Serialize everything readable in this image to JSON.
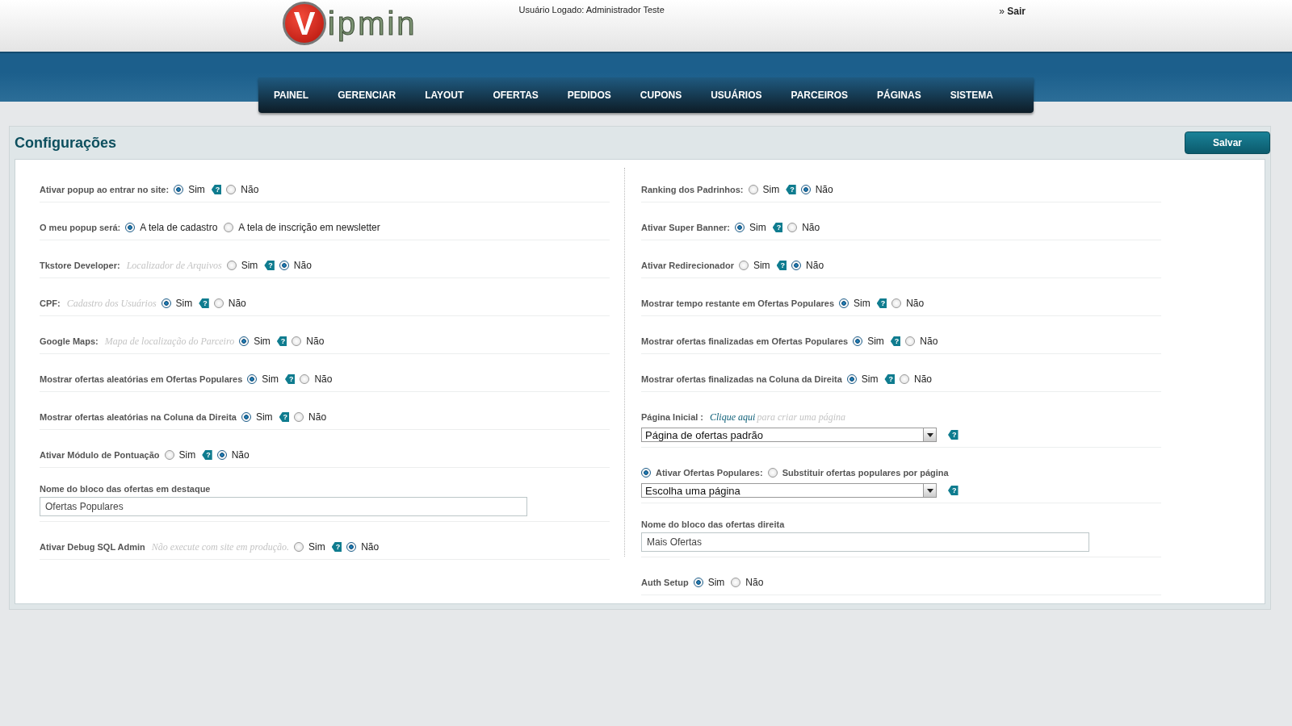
{
  "header": {
    "logo_mark": "V",
    "logo_text": "ipmin",
    "user": "Usuário Logado: Administrador Teste",
    "logout_mark": "»",
    "logout": "Sair"
  },
  "nav": [
    {
      "label": "PAINEL"
    },
    {
      "label": "GERENCIAR"
    },
    {
      "label": "LAYOUT"
    },
    {
      "label": "OFERTAS"
    },
    {
      "label": "PEDIDOS"
    },
    {
      "label": "CUPONS"
    },
    {
      "label": "USUÁRIOS"
    },
    {
      "label": "PARCEIROS"
    },
    {
      "label": "PÁGINAS"
    },
    {
      "label": "SISTEMA"
    }
  ],
  "panel": {
    "title": "Configurações",
    "save": "Salvar"
  },
  "left": [
    {
      "kind": "radio",
      "label": "Ativar popup ao entrar no site:",
      "help": "?",
      "options": [
        {
          "label": "Sim",
          "selected": true
        },
        {
          "label": "Não",
          "selected": false
        }
      ]
    },
    {
      "kind": "radio",
      "label": "O meu popup será:",
      "options": [
        {
          "label": "A tela de cadastro",
          "selected": true
        },
        {
          "label": "A tela de inscrição em newsletter",
          "selected": false
        }
      ]
    },
    {
      "kind": "radio",
      "label": "Tkstore Developer:",
      "hint": "Localizador de Arquivos",
      "help": "?",
      "options": [
        {
          "label": "Sim",
          "selected": false
        },
        {
          "label": "Não",
          "selected": true
        }
      ]
    },
    {
      "kind": "radio",
      "label": "CPF:",
      "hint": "Cadastro dos Usuários",
      "help": "?",
      "options": [
        {
          "label": "Sim",
          "selected": true
        },
        {
          "label": "Não",
          "selected": false
        }
      ]
    },
    {
      "kind": "radio",
      "label": "Google Maps:",
      "hint": "Mapa de localização do Parceiro",
      "help": "?",
      "options": [
        {
          "label": "Sim",
          "selected": true
        },
        {
          "label": "Não",
          "selected": false
        }
      ]
    },
    {
      "kind": "radio",
      "label": "Mostrar ofertas aleatórias em Ofertas Populares",
      "help": "?",
      "options": [
        {
          "label": "Sim",
          "selected": true
        },
        {
          "label": "Não",
          "selected": false
        }
      ]
    },
    {
      "kind": "radio",
      "label": "Mostrar ofertas aleatórias na Coluna da Direita",
      "help": "?",
      "options": [
        {
          "label": "Sim",
          "selected": true
        },
        {
          "label": "Não",
          "selected": false
        }
      ]
    },
    {
      "kind": "radio",
      "label": "Ativar Módulo de Pontuação",
      "help": "?",
      "options": [
        {
          "label": "Sim",
          "selected": false
        },
        {
          "label": "Não",
          "selected": true
        }
      ]
    },
    {
      "kind": "text",
      "label": "Nome do bloco das ofertas em destaque",
      "value": "Ofertas Populares"
    },
    {
      "kind": "radio",
      "label": "Ativar Debug SQL Admin",
      "hint": "Não execute com site em produção.",
      "help": "?",
      "options": [
        {
          "label": "Sim",
          "selected": false
        },
        {
          "label": "Não",
          "selected": true
        }
      ]
    }
  ],
  "right": [
    {
      "kind": "radio",
      "label": "Ranking dos Padrinhos:",
      "help": "?",
      "options": [
        {
          "label": "Sim",
          "selected": false
        },
        {
          "label": "Não",
          "selected": true
        }
      ]
    },
    {
      "kind": "radio",
      "label": "Ativar Super Banner:",
      "help": "?",
      "options": [
        {
          "label": "Sim",
          "selected": true
        },
        {
          "label": "Não",
          "selected": false
        }
      ]
    },
    {
      "kind": "radio",
      "label": "Ativar Redirecionador",
      "help": "?",
      "options": [
        {
          "label": "Sim",
          "selected": false
        },
        {
          "label": "Não",
          "selected": true
        }
      ]
    },
    {
      "kind": "radio",
      "label": "Mostrar tempo restante em Ofertas Populares",
      "help": "?",
      "options": [
        {
          "label": "Sim",
          "selected": true
        },
        {
          "label": "Não",
          "selected": false
        }
      ]
    },
    {
      "kind": "radio",
      "label": "Mostrar ofertas finalizadas em Ofertas Populares",
      "help": "?",
      "options": [
        {
          "label": "Sim",
          "selected": true
        },
        {
          "label": "Não",
          "selected": false
        }
      ]
    },
    {
      "kind": "radio",
      "label": "Mostrar ofertas finalizadas na Coluna da Direita",
      "help": "?",
      "options": [
        {
          "label": "Sim",
          "selected": true
        },
        {
          "label": "Não",
          "selected": false
        }
      ]
    },
    {
      "kind": "select",
      "label": "Página Inicial :",
      "link": "Clique aqui",
      "hint": "para criar uma página",
      "value": "Página de ofertas padrão",
      "help": "?"
    },
    {
      "kind": "radio-select",
      "options": [
        {
          "label": "Ativar Ofertas Populares:",
          "selected": true
        },
        {
          "label": "Substituir ofertas populares por página",
          "selected": false
        }
      ],
      "value": "Escolha uma página",
      "help": "?"
    },
    {
      "kind": "text",
      "label": "Nome do bloco das ofertas direita",
      "value": "Mais Ofertas"
    },
    {
      "kind": "radio",
      "label": "Auth Setup",
      "options": [
        {
          "label": "Sim",
          "selected": true
        },
        {
          "label": "Não",
          "selected": false
        }
      ]
    }
  ]
}
